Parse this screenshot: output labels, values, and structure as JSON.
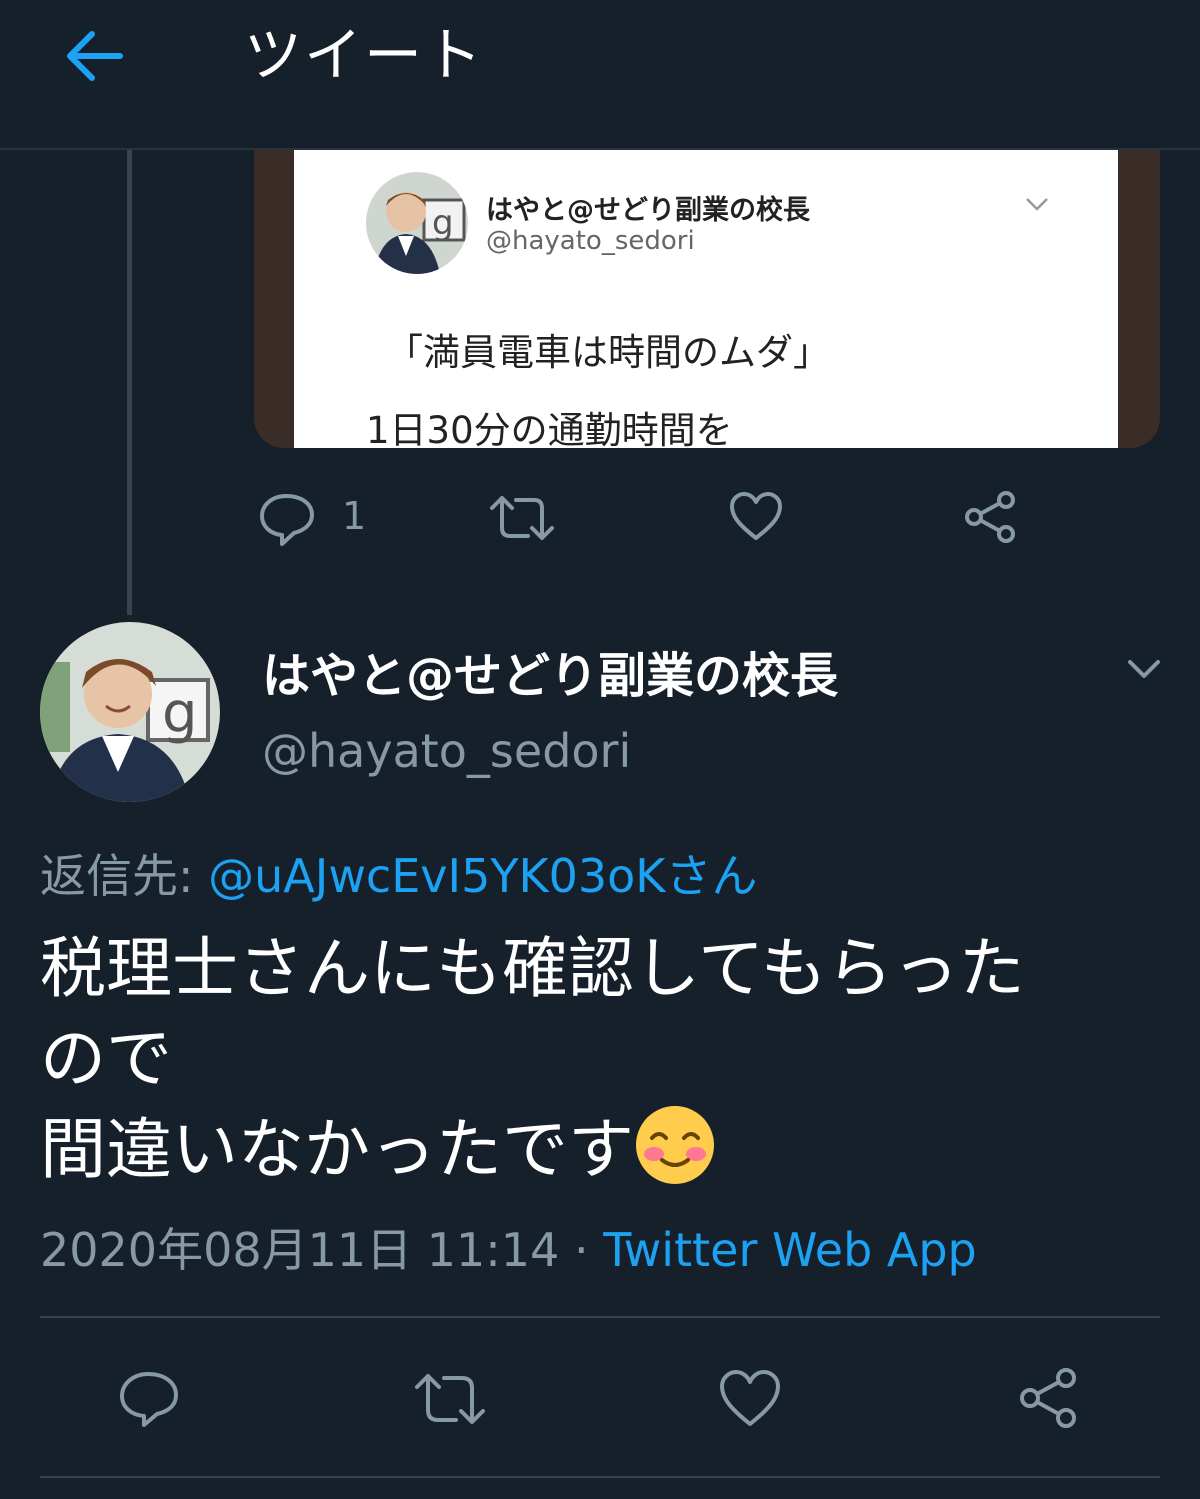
{
  "header": {
    "title": "ツイート",
    "back_icon": "arrow-left-icon",
    "accent_color": "#1da1f2"
  },
  "quoted_media": {
    "name": "はやと@せどり副業の校長",
    "handle": "@hayato_sedori",
    "line1": "「満員電車は時間のムダ」",
    "line2": "1日30分の通勤時間を"
  },
  "parent_actions": {
    "reply_count": "1",
    "icons": [
      "reply-icon",
      "retweet-icon",
      "like-icon",
      "share-icon"
    ]
  },
  "tweet": {
    "name": "はやと@せどり副業の校長",
    "handle": "@hayato_sedori",
    "reply_prefix": "返信先: ",
    "reply_target": "@uAJwcEvI5YK03oKさん",
    "body_line1": "税理士さんにも確認してもらった",
    "body_line2": "ので",
    "body_line3": "間違いなかったです",
    "emoji": "smiling-face-with-blush-icon",
    "timestamp": "2020年08月11日 11:14 · ",
    "source": "Twitter Web App"
  },
  "tweet_actions": {
    "icons": [
      "reply-icon",
      "retweet-icon",
      "like-icon",
      "share-icon"
    ]
  }
}
